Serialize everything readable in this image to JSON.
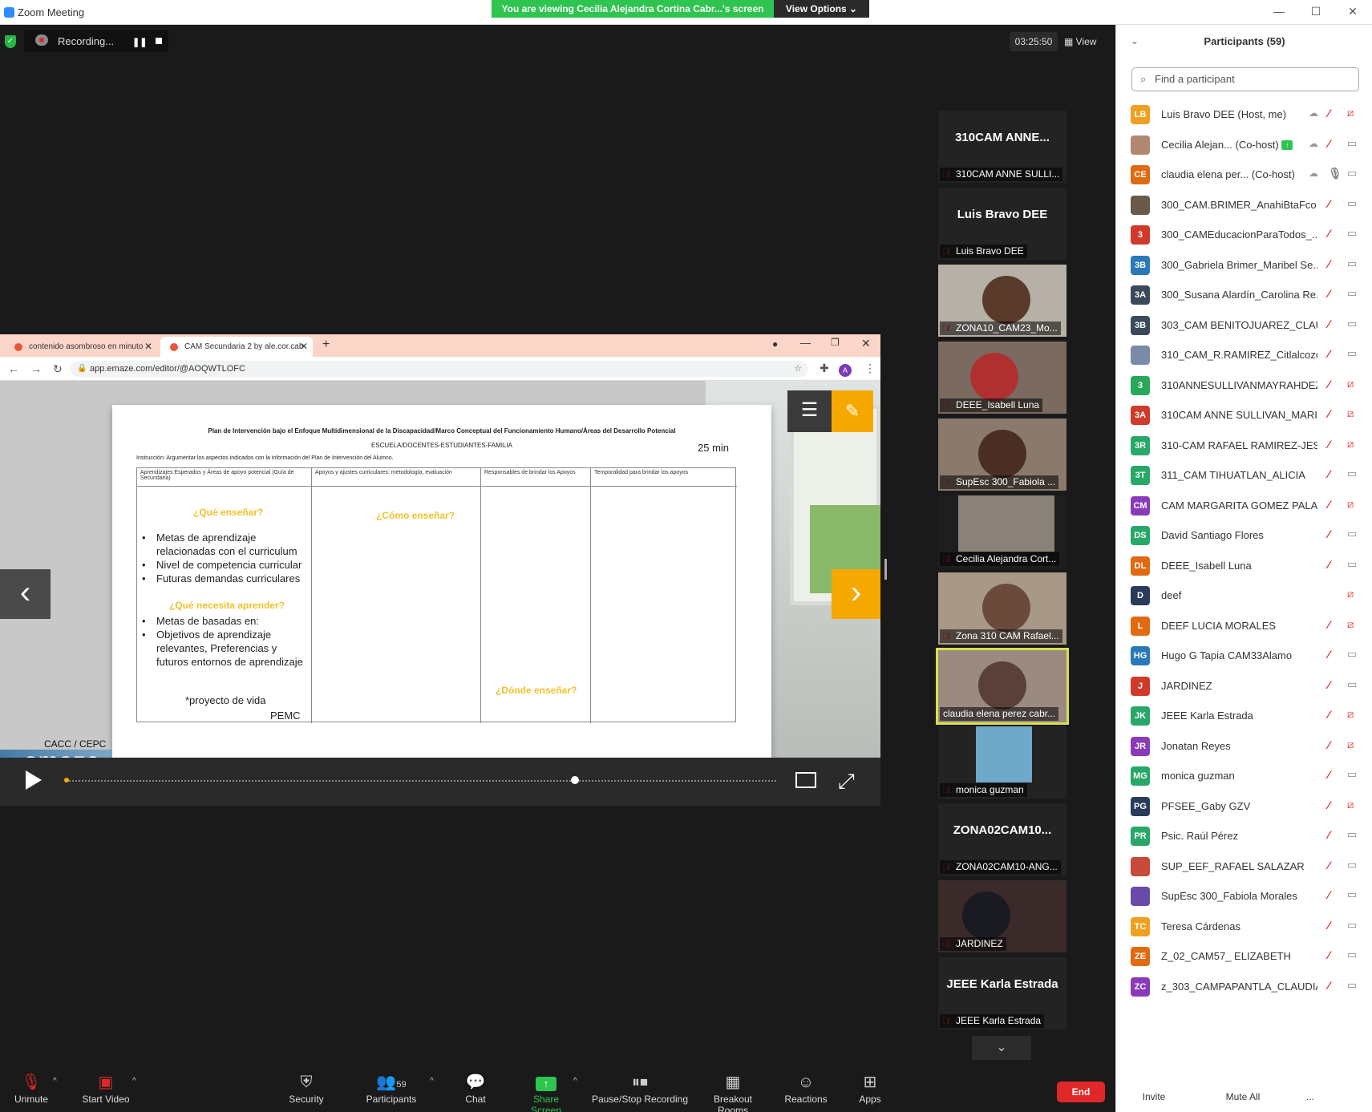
{
  "window": {
    "title": "Zoom Meeting"
  },
  "banner": {
    "viewing": "You are viewing Cecilia Alejandra Cortina Cabr...'s screen",
    "view_options": "View Options ⌄"
  },
  "recording": {
    "status": "Recording...",
    "pause": "❚❚"
  },
  "meeting": {
    "timer": "03:25:50",
    "view_label": "View"
  },
  "browser": {
    "tabs": [
      {
        "label": "contenido asombroso en minuto"
      },
      {
        "label": "CAM Secundaria 2 by ale.cor.cab"
      }
    ],
    "url": "app.emaze.com/editor/@AOQWTLOFC",
    "profile_initial": "A"
  },
  "slide": {
    "title": "Plan de Intervención bajo el Enfoque Multidimensional de la Discapacidad/Marco Conceptual del Funcionamiento Humano/Áreas del Desarrollo Potencial",
    "subtitle": "ESCUELA/DOCENTES-ESTUDIANTES-FAMILIA",
    "time": "25 min",
    "instruction": "Instrucción: Argumentar los aspectos indicados con la información del Plan de Intervención del Alumno.",
    "headers": [
      "Aprendizajes Esperados y Áreas de apoyo potencial (Guía de Secundaria)",
      "Apoyos y ajustes curriculares: metodología, evaluación",
      "Responsables de brindar los Apoyos",
      "Temporalidad para brindar los apoyos"
    ],
    "que_ensenar": "¿Qué enseñar?",
    "como_ensenar": "¿Cómo enseñar?",
    "que_necesita": "¿Qué necesita aprender?",
    "donde_ensenar": "¿Dónde enseñar?",
    "bullets_1": [
      "Metas de aprendizaje relacionadas con el curriculum",
      "Nivel de competencia curricular",
      "Futuras demandas curriculares"
    ],
    "bullets_2": [
      "Metas de basadas en:",
      "Objetivos de aprendizaje relevantes, Preferencias y futuros entornos de aprendizaje"
    ],
    "proyecto": "*proyecto de vida",
    "pemc": "PEMC",
    "cacc": "CACC / CEPC",
    "brand": "emaze"
  },
  "gallery": [
    {
      "name": "310CAM ANNE...",
      "label": "310CAM ANNE SULLI...",
      "video": false
    },
    {
      "name": "Luis Bravo DEE",
      "label": "Luis Bravo DEE",
      "video": false
    },
    {
      "name": "",
      "label": "ZONA10_CAM23_Mo...",
      "video": true
    },
    {
      "name": "",
      "label": "DEEE_Isabell Luna",
      "video": true
    },
    {
      "name": "",
      "label": "SupEsc 300_Fabiola ...",
      "video": true
    },
    {
      "name": "",
      "label": "Cecilia Alejandra Cort...",
      "video": true
    },
    {
      "name": "",
      "label": "Zona 310 CAM Rafael...",
      "video": true
    },
    {
      "name": "",
      "label": "claudia elena perez cabr...",
      "video": true
    },
    {
      "name": "",
      "label": "monica guzman",
      "video": true
    },
    {
      "name": "ZONA02CAM10...",
      "label": "ZONA02CAM10-ANG...",
      "video": false
    },
    {
      "name": "",
      "label": "JARDINEZ",
      "video": true
    },
    {
      "name": "JEEE Karla Estrada",
      "label": "JEEE Karla Estrada",
      "video": false
    }
  ],
  "toolbar": {
    "unmute": "Unmute",
    "start_video": "Start Video",
    "security": "Security",
    "participants": "Participants",
    "participants_count": "59",
    "chat": "Chat",
    "share_screen": "Share Screen",
    "pause_stop": "Pause/Stop Recording",
    "breakout": "Breakout Rooms",
    "reactions": "Reactions",
    "apps": "Apps",
    "end": "End"
  },
  "panel": {
    "title": "Participants (59)",
    "search_placeholder": "Find a participant",
    "participants": [
      {
        "initials": "LB",
        "color": "#f0a020",
        "name": "Luis Bravo DEE (Host, me)",
        "mic": "off",
        "cam": "off",
        "cloud": true
      },
      {
        "initials": "",
        "color": "#b08870",
        "name": "Cecilia Alejan...  (Co-host)",
        "mic": "off",
        "cam": "on",
        "cloud": true,
        "sharing": true
      },
      {
        "initials": "CE",
        "color": "#e06a10",
        "name": "claudia elena per...  (Co-host)",
        "mic": "on",
        "cam": "on",
        "cloud": true
      },
      {
        "initials": "",
        "color": "#6a5a4a",
        "name": "300_CAM.BRIMER_AnahiBtaFco",
        "mic": "off",
        "cam": "on"
      },
      {
        "initials": "3",
        "color": "#d03a2a",
        "name": "300_CAMEducacionParaTodos_...",
        "mic": "off",
        "cam": "on"
      },
      {
        "initials": "3B",
        "color": "#2a7ab8",
        "name": "300_Gabriela Brimer_Maribel Se...",
        "mic": "off",
        "cam": "on"
      },
      {
        "initials": "3A",
        "color": "#3a4a5a",
        "name": "300_Susana Alardín_Carolina Re...",
        "mic": "off",
        "cam": "on"
      },
      {
        "initials": "3B",
        "color": "#3a4a5a",
        "name": "303_CAM BENITOJUAREZ_CLAU...",
        "mic": "off",
        "cam": "on"
      },
      {
        "initials": "",
        "color": "#7a8aa8",
        "name": "310_CAM_R.RAMIREZ_Citlalcozc...",
        "mic": "off",
        "cam": "on"
      },
      {
        "initials": "3",
        "color": "#28a858",
        "name": "310ANNESULLIVANMAYRAHDEZ",
        "mic": "off",
        "cam": "off"
      },
      {
        "initials": "3A",
        "color": "#d03a2a",
        "name": "310CAM ANNE SULLIVAN_MARI...",
        "mic": "off",
        "cam": "off"
      },
      {
        "initials": "3R",
        "color": "#28a868",
        "name": "310-CAM RAFAEL RAMIREZ-JES...",
        "mic": "off",
        "cam": "off"
      },
      {
        "initials": "3T",
        "color": "#28a868",
        "name": "311_CAM TIHUATLAN_ALICIA",
        "mic": "off",
        "cam": "on"
      },
      {
        "initials": "CM",
        "color": "#8a3ab8",
        "name": "CAM MARGARITA GOMEZ PALA...",
        "mic": "off",
        "cam": "off"
      },
      {
        "initials": "DS",
        "color": "#28a868",
        "name": "David Santiago Flores",
        "mic": "off",
        "cam": "on"
      },
      {
        "initials": "DL",
        "color": "#e06a10",
        "name": "DEEE_Isabell Luna",
        "mic": "off",
        "cam": "on"
      },
      {
        "initials": "D",
        "color": "#2a3a5a",
        "name": "deef",
        "mic": "none",
        "cam": "offred"
      },
      {
        "initials": "L",
        "color": "#e06a10",
        "name": "DEEF LUCIA MORALES",
        "mic": "off",
        "cam": "off"
      },
      {
        "initials": "HG",
        "color": "#2a7ab8",
        "name": "Hugo G Tapia CAM33Alamo",
        "mic": "off",
        "cam": "on"
      },
      {
        "initials": "J",
        "color": "#d03a2a",
        "name": "JARDINEZ",
        "mic": "off",
        "cam": "on"
      },
      {
        "initials": "JK",
        "color": "#28a868",
        "name": "JEEE Karla Estrada",
        "mic": "off",
        "cam": "off"
      },
      {
        "initials": "JR",
        "color": "#8a3ab8",
        "name": "Jonatan Reyes",
        "mic": "off",
        "cam": "off"
      },
      {
        "initials": "MG",
        "color": "#28a868",
        "name": "monica guzman",
        "mic": "off",
        "cam": "on"
      },
      {
        "initials": "PG",
        "color": "#2a3a5a",
        "name": "PFSEE_Gaby GZV",
        "mic": "off",
        "cam": "off"
      },
      {
        "initials": "PR",
        "color": "#28a868",
        "name": "Psic. Raúl Pérez",
        "mic": "off",
        "cam": "on"
      },
      {
        "initials": "",
        "color": "#c84a3a",
        "name": "SUP_EEF_RAFAEL SALAZAR",
        "mic": "off",
        "cam": "on"
      },
      {
        "initials": "",
        "color": "#6a4aa8",
        "name": "SupEsc 300_Fabiola Morales",
        "mic": "off",
        "cam": "on"
      },
      {
        "initials": "TC",
        "color": "#f0a020",
        "name": "Teresa Cárdenas",
        "mic": "off",
        "cam": "on"
      },
      {
        "initials": "ZE",
        "color": "#e06a10",
        "name": "Z_02_CAM57_ ELIZABETH",
        "mic": "off",
        "cam": "on"
      },
      {
        "initials": "ZC",
        "color": "#8a3ab8",
        "name": "z_303_CAMPAPANTLA_CLAUDIA ...",
        "mic": "off",
        "cam": "on"
      }
    ],
    "invite": "Invite",
    "mute_all": "Mute All",
    "more": "..."
  }
}
